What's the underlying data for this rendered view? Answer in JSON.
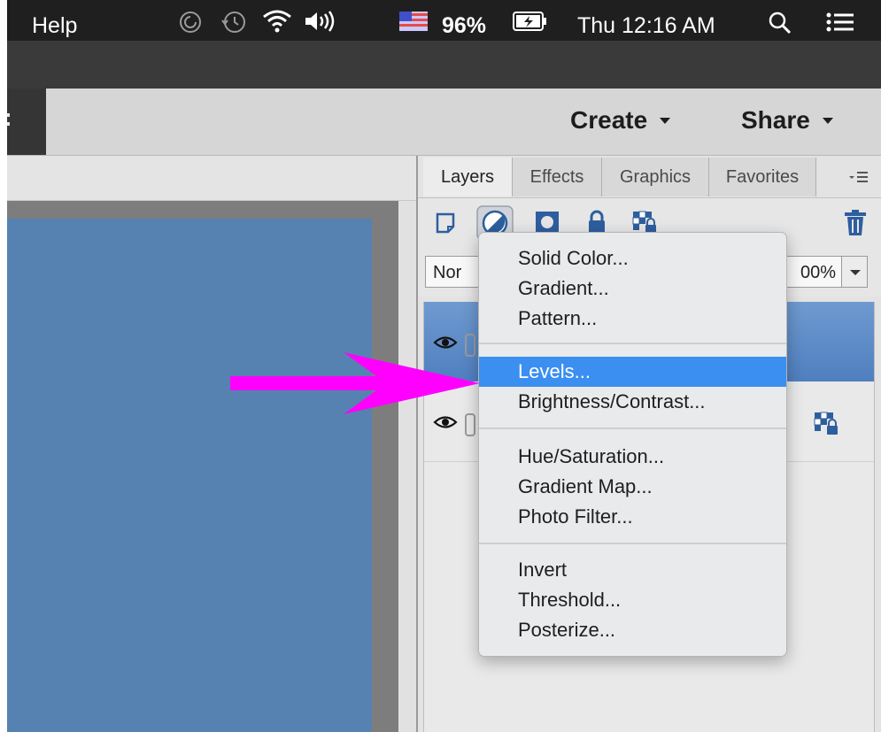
{
  "menubar": {
    "app_menu": "Help",
    "battery": "96%",
    "datetime": "Thu 12:16 AM"
  },
  "toolbar": {
    "create_label": "Create",
    "share_label": "Share"
  },
  "panel": {
    "tabs": [
      {
        "label": "Layers"
      },
      {
        "label": "Effects"
      },
      {
        "label": "Graphics"
      },
      {
        "label": "Favorites"
      }
    ],
    "blend_mode": "Nor",
    "opacity": "00%"
  },
  "dropdown": {
    "items": [
      {
        "label": "Solid Color..."
      },
      {
        "label": "Gradient..."
      },
      {
        "label": "Pattern..."
      },
      {
        "label": "Levels..."
      },
      {
        "label": "Brightness/Contrast..."
      },
      {
        "label": "Hue/Saturation..."
      },
      {
        "label": "Gradient Map..."
      },
      {
        "label": "Photo Filter..."
      },
      {
        "label": "Invert"
      },
      {
        "label": "Threshold..."
      },
      {
        "label": "Posterize..."
      }
    ],
    "highlighted": "Levels..."
  },
  "colors": {
    "canvas_fill": "#5582b0",
    "annotation_arrow": "#ff00ff",
    "menu_highlight": "#3b8ff0",
    "selected_layer": "#5f8dc8"
  },
  "icons": [
    "do-not-disturb-icon",
    "time-machine-icon",
    "wifi-icon",
    "volume-icon",
    "flag-icon",
    "battery-charging-icon",
    "spotlight-search-icon",
    "notification-center-icon",
    "new-layer-icon",
    "adjustment-layer-icon",
    "layer-mask-icon",
    "lock-icon",
    "lock-transparency-icon",
    "trash-icon",
    "eye-icon",
    "panel-menu-icon",
    "annotation-arrow"
  ]
}
